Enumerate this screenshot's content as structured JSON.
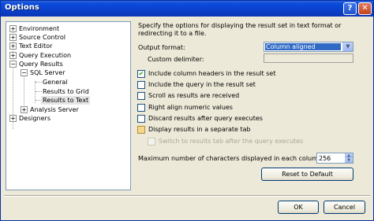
{
  "window": {
    "title": "Options"
  },
  "titlebar": {
    "help_icon": "?",
    "close_icon": "✕"
  },
  "tree": {
    "items": [
      {
        "label": "Environment",
        "expander": "+"
      },
      {
        "label": "Source Control",
        "expander": "+"
      },
      {
        "label": "Text Editor",
        "expander": "+"
      },
      {
        "label": "Query Execution",
        "expander": "+"
      },
      {
        "label": "Query Results",
        "expander": "−"
      },
      {
        "label": "SQL Server",
        "expander": "−"
      },
      {
        "label": "General"
      },
      {
        "label": "Results to Grid"
      },
      {
        "label": "Results to Text",
        "selected": true
      },
      {
        "label": "Analysis Server",
        "expander": "+"
      },
      {
        "label": "Designers",
        "expander": "+"
      }
    ]
  },
  "panel": {
    "description": "Specify the options for displaying the result set in text format or redirecting it to a file.",
    "output_format_label": "Output format:",
    "output_format_value": "Column aligned",
    "custom_delimiter_label": "Custom delimiter:",
    "custom_delimiter_value": "",
    "checkboxes": [
      {
        "label": "Include column headers in the result set",
        "checked": true,
        "mark": "✔"
      },
      {
        "label": "Include the query in the result set",
        "checked": false
      },
      {
        "label": "Scroll as results are received",
        "checked": false
      },
      {
        "label": "Right align numeric values",
        "checked": false
      },
      {
        "label": "Discard results after query executes",
        "checked": false
      },
      {
        "label": "Display results in a separate tab",
        "checked": false
      },
      {
        "label": "Switch to results tab after the query executes",
        "checked": false,
        "disabled": true
      }
    ],
    "max_chars_label": "Maximum number of characters displayed in each column:",
    "max_chars_value": "256",
    "reset_button": "Reset to Default"
  },
  "footer": {
    "ok_button": "OK",
    "cancel_button": "Cancel"
  },
  "colors": {
    "title_bar": "#0a4adb",
    "selection": "#316ac5",
    "window_bg": "#ece9d8"
  }
}
